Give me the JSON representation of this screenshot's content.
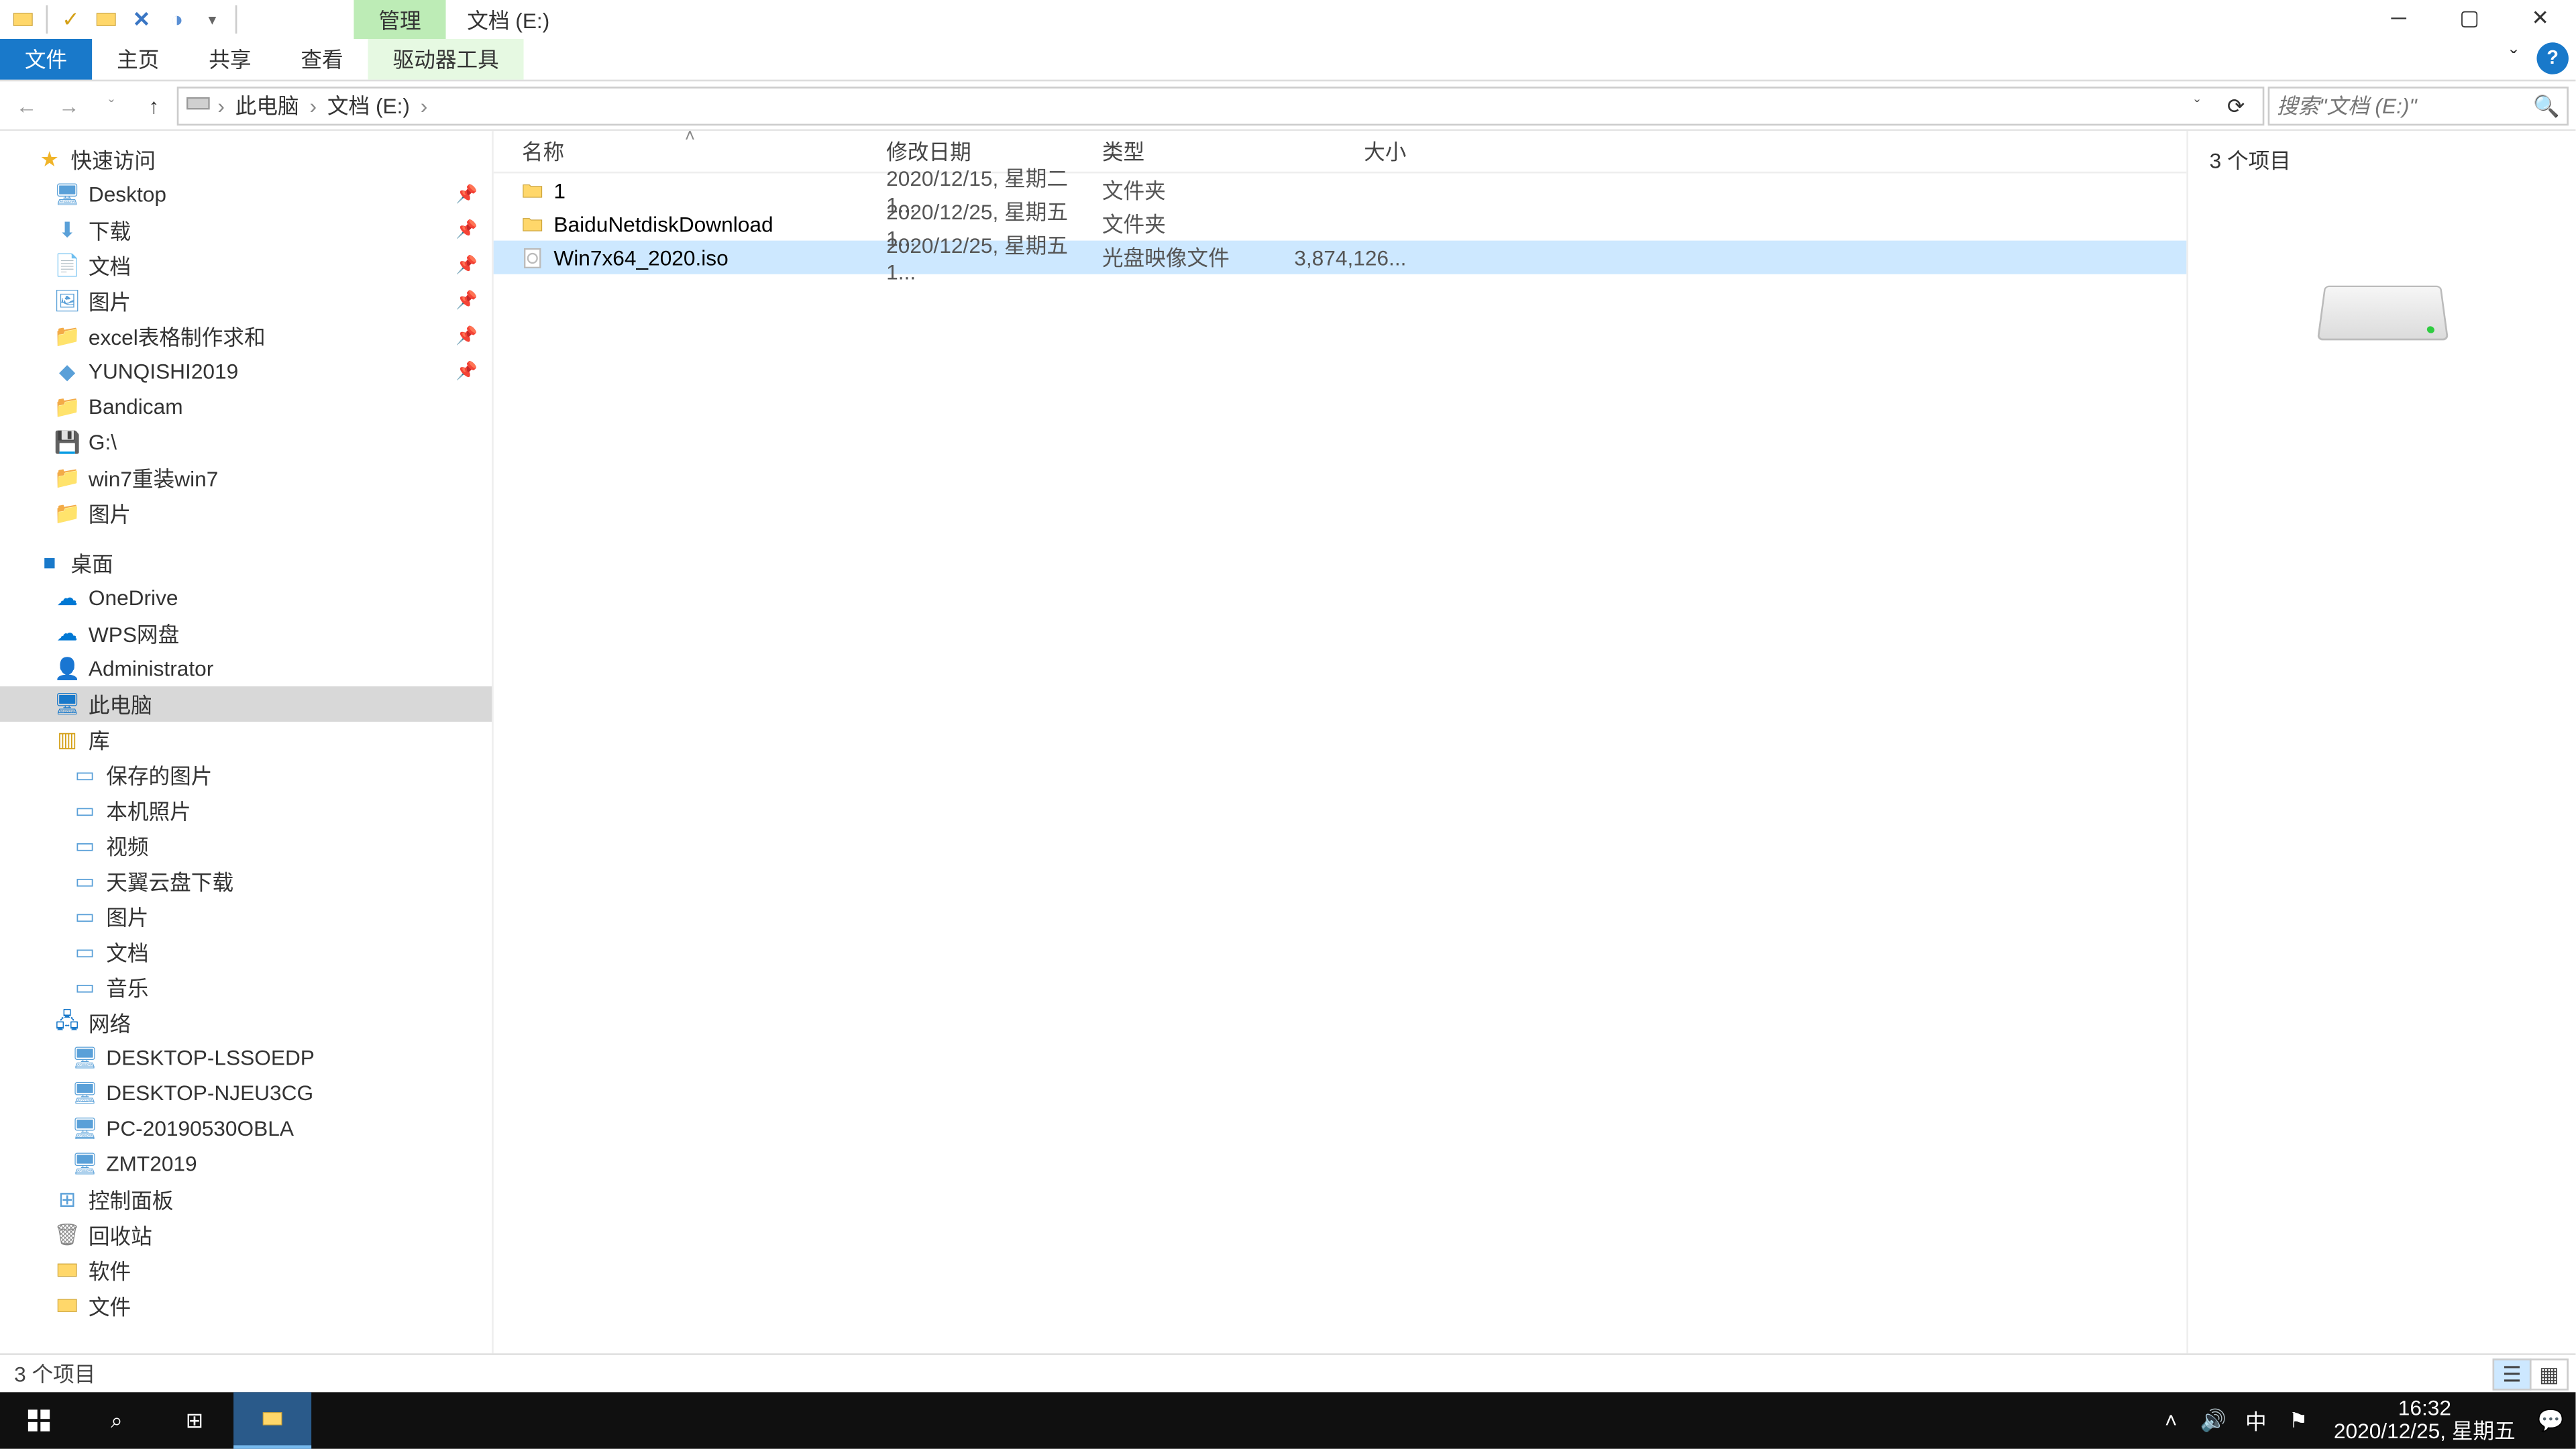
{
  "titlebar": {
    "context_tab": "管理",
    "title": "文档 (E:)"
  },
  "ribbon": {
    "file": "文件",
    "home": "主页",
    "share": "共享",
    "view": "查看",
    "drive_tools": "驱动器工具"
  },
  "addr": {
    "crumb1": "此电脑",
    "crumb2": "文档 (E:)"
  },
  "search": {
    "placeholder": "搜索\"文档 (E:)\""
  },
  "nav": {
    "quick_access": "快速访问",
    "items_qa": [
      {
        "label": "Desktop",
        "icon": "desktop",
        "pinned": true
      },
      {
        "label": "下载",
        "icon": "download",
        "pinned": true
      },
      {
        "label": "文档",
        "icon": "doc",
        "pinned": true
      },
      {
        "label": "图片",
        "icon": "pic",
        "pinned": true
      },
      {
        "label": "excel表格制作求和",
        "icon": "folder",
        "pinned": true
      },
      {
        "label": "YUNQISHI2019",
        "icon": "app",
        "pinned": true
      },
      {
        "label": "Bandicam",
        "icon": "folder",
        "pinned": false
      },
      {
        "label": "G:\\",
        "icon": "drive",
        "pinned": false
      },
      {
        "label": "win7重装win7",
        "icon": "folder",
        "pinned": false
      },
      {
        "label": "图片",
        "icon": "folder",
        "pinned": false
      }
    ],
    "desktop": "桌面",
    "onedrive": "OneDrive",
    "wps": "WPS网盘",
    "admin": "Administrator",
    "this_pc": "此电脑",
    "libraries": "库",
    "lib_items": [
      "保存的图片",
      "本机照片",
      "视频",
      "天翼云盘下载",
      "图片",
      "文档",
      "音乐"
    ],
    "network": "网络",
    "net_items": [
      "DESKTOP-LSSOEDP",
      "DESKTOP-NJEU3CG",
      "PC-20190530OBLA",
      "ZMT2019"
    ],
    "control_panel": "控制面板",
    "recycle": "回收站",
    "soft": "软件",
    "docs": "文件"
  },
  "columns": {
    "name": "名称",
    "date": "修改日期",
    "type": "类型",
    "size": "大小"
  },
  "files": [
    {
      "name": "1",
      "date": "2020/12/15, 星期二 1...",
      "type": "文件夹",
      "size": "",
      "icon": "folder",
      "selected": false
    },
    {
      "name": "BaiduNetdiskDownload",
      "date": "2020/12/25, 星期五 1...",
      "type": "文件夹",
      "size": "",
      "icon": "folder",
      "selected": false
    },
    {
      "name": "Win7x64_2020.iso",
      "date": "2020/12/25, 星期五 1...",
      "type": "光盘映像文件",
      "size": "3,874,126...",
      "icon": "iso",
      "selected": true
    }
  ],
  "preview": {
    "header": "3 个项目"
  },
  "status": {
    "text": "3 个项目"
  },
  "clock": {
    "time": "16:32",
    "date": "2020/12/25, 星期五"
  },
  "tray": {
    "ime": "中"
  }
}
